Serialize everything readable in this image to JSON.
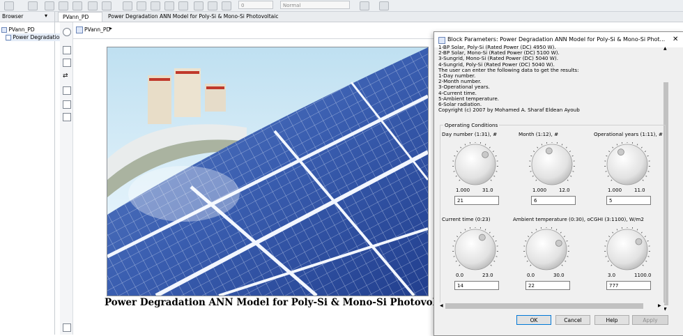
{
  "toolbar": {
    "zoom_value": "0",
    "mode_value": "Normal"
  },
  "browser": {
    "header": "Browser",
    "items": [
      {
        "label": "PVann_PD"
      },
      {
        "label": "Power Degradation"
      }
    ]
  },
  "tabs": [
    {
      "label": "PVann_PD"
    },
    {
      "label": "Power Degradation ANN Model for Poly-Si & Mono-Si Photovoltaic"
    }
  ],
  "breadcrumb": {
    "label": "PVann_PD"
  },
  "canvas": {
    "caption": "Power Degradation ANN Model for Poly-Si & Mono-Si Photovoltaic"
  },
  "dialog": {
    "title": "Block Parameters: Power Degradation ANN Model for Poly-Si & Mono-Si Phot...",
    "description": [
      "1-BP Solar, Poly-Si (Rated Power (DC) 4950 W).",
      "2-BP Solar, Mono-Si (Rated Power (DC) 5100 W).",
      "3-Sungrid, Mono-Si (Rated Power (DC) 5040 W).",
      "4-Sungrid, Poly-Si (Rated Power (DC) 5040 W).",
      "The user can enter the following data to get the results:",
      "1-Day number.",
      "2-Month number.",
      "3-Operational years.",
      "4-Current time.",
      "5-Ambient temperature.",
      "6-Solar radiation.",
      "Copyright (c) 2007 by Mohamed A. Sharaf Eldean Ayoub"
    ],
    "group_label": "Operating Conditions",
    "knobs": [
      {
        "label": "Day number (1:31), #",
        "min": "1.000",
        "max": "31.0",
        "value": "21",
        "level": 0.667
      },
      {
        "label": "Month (1:12), #",
        "min": "1.000",
        "max": "12.0",
        "value": "6",
        "level": 0.455
      },
      {
        "label": "Operational years (1:11), #",
        "min": "1.000",
        "max": "11.0",
        "value": "5",
        "level": 0.4
      },
      {
        "label": "Current time (0:23)",
        "min": "0.0",
        "max": "23.0",
        "value": "14",
        "level": 0.609
      },
      {
        "label": "Ambient temperature (0:30), oC",
        "min": "0.0",
        "max": "30.0",
        "value": "22",
        "level": 0.733
      },
      {
        "label": "GHI (3:1100), W/m2",
        "min": "3.0",
        "max": "1100.0",
        "value": "777",
        "level": 0.705
      }
    ],
    "buttons": {
      "ok": "OK",
      "cancel": "Cancel",
      "help": "Help",
      "apply": "Apply"
    }
  }
}
